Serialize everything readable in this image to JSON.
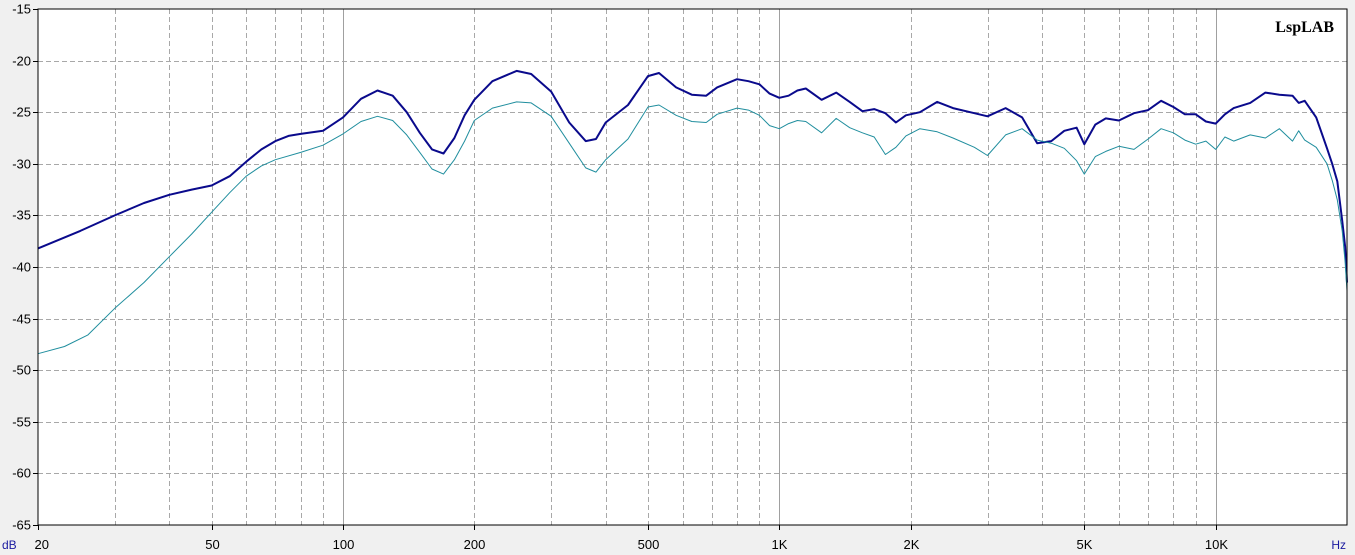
{
  "chart_data": {
    "type": "line",
    "brand": "LspLAB",
    "y_unit_label": "dB",
    "x_unit_label": "Hz",
    "x_scale": "log",
    "xlim": [
      20,
      20000
    ],
    "ylim": [
      -65,
      -15
    ],
    "grid": true,
    "x_ticks": [
      {
        "value": 20,
        "label": "20"
      },
      {
        "value": 50,
        "label": "50"
      },
      {
        "value": 100,
        "label": "100"
      },
      {
        "value": 200,
        "label": "200"
      },
      {
        "value": 500,
        "label": "500"
      },
      {
        "value": 1000,
        "label": "1K"
      },
      {
        "value": 2000,
        "label": "2K"
      },
      {
        "value": 5000,
        "label": "5K"
      },
      {
        "value": 10000,
        "label": "10K"
      }
    ],
    "y_ticks": [
      {
        "value": -15,
        "label": "-15"
      },
      {
        "value": -20,
        "label": "-20"
      },
      {
        "value": -25,
        "label": "-25"
      },
      {
        "value": -30,
        "label": "-30"
      },
      {
        "value": -35,
        "label": "-35"
      },
      {
        "value": -40,
        "label": "-40"
      },
      {
        "value": -45,
        "label": "-45"
      },
      {
        "value": -50,
        "label": "-50"
      },
      {
        "value": -55,
        "label": "-55"
      },
      {
        "value": -60,
        "label": "-60"
      },
      {
        "value": -65,
        "label": "-65"
      }
    ],
    "colors": {
      "background": "#ffffff",
      "grid_major": "#a0a0a0",
      "grid_minor": "#a8a8a8"
    },
    "series": [
      {
        "color": "#0a0a8c",
        "points": [
          [
            20,
            -38.2
          ],
          [
            25,
            -36.5
          ],
          [
            30,
            -35
          ],
          [
            35,
            -33.8
          ],
          [
            40,
            -33
          ],
          [
            45,
            -32.5
          ],
          [
            50,
            -32.1
          ],
          [
            55,
            -31.2
          ],
          [
            60,
            -29.8
          ],
          [
            65,
            -28.6
          ],
          [
            70,
            -27.8
          ],
          [
            75,
            -27.3
          ],
          [
            80,
            -27.1
          ],
          [
            90,
            -26.8
          ],
          [
            100,
            -25.5
          ],
          [
            110,
            -23.7
          ],
          [
            120,
            -22.9
          ],
          [
            130,
            -23.4
          ],
          [
            140,
            -25
          ],
          [
            150,
            -27
          ],
          [
            160,
            -28.6
          ],
          [
            170,
            -29
          ],
          [
            180,
            -27.5
          ],
          [
            190,
            -25.3
          ],
          [
            200,
            -23.8
          ],
          [
            220,
            -22
          ],
          [
            250,
            -21
          ],
          [
            270,
            -21.3
          ],
          [
            300,
            -23
          ],
          [
            330,
            -26
          ],
          [
            360,
            -27.8
          ],
          [
            380,
            -27.6
          ],
          [
            400,
            -26
          ],
          [
            450,
            -24.3
          ],
          [
            500,
            -21.5
          ],
          [
            530,
            -21.2
          ],
          [
            580,
            -22.6
          ],
          [
            630,
            -23.3
          ],
          [
            680,
            -23.4
          ],
          [
            720,
            -22.6
          ],
          [
            800,
            -21.8
          ],
          [
            850,
            -22
          ],
          [
            900,
            -22.3
          ],
          [
            950,
            -23.2
          ],
          [
            1000,
            -23.6
          ],
          [
            1050,
            -23.4
          ],
          [
            1100,
            -22.9
          ],
          [
            1150,
            -22.7
          ],
          [
            1250,
            -23.8
          ],
          [
            1350,
            -23.1
          ],
          [
            1450,
            -24
          ],
          [
            1550,
            -24.9
          ],
          [
            1650,
            -24.7
          ],
          [
            1750,
            -25.1
          ],
          [
            1850,
            -26
          ],
          [
            1950,
            -25.3
          ],
          [
            2100,
            -25
          ],
          [
            2300,
            -24
          ],
          [
            2500,
            -24.6
          ],
          [
            2800,
            -25.1
          ],
          [
            3000,
            -25.4
          ],
          [
            3300,
            -24.6
          ],
          [
            3600,
            -25.5
          ],
          [
            3900,
            -28
          ],
          [
            4200,
            -27.8
          ],
          [
            4500,
            -26.8
          ],
          [
            4800,
            -26.5
          ],
          [
            5000,
            -28.1
          ],
          [
            5300,
            -26.2
          ],
          [
            5600,
            -25.6
          ],
          [
            6000,
            -25.8
          ],
          [
            6500,
            -25.1
          ],
          [
            7000,
            -24.8
          ],
          [
            7500,
            -23.9
          ],
          [
            8000,
            -24.5
          ],
          [
            8500,
            -25.2
          ],
          [
            9000,
            -25.2
          ],
          [
            9500,
            -25.9
          ],
          [
            10000,
            -26.1
          ],
          [
            10500,
            -25.2
          ],
          [
            11000,
            -24.6
          ],
          [
            12000,
            -24.1
          ],
          [
            13000,
            -23.1
          ],
          [
            14000,
            -23.3
          ],
          [
            15000,
            -23.4
          ],
          [
            15500,
            -24.1
          ],
          [
            16000,
            -23.9
          ],
          [
            17000,
            -25.5
          ],
          [
            18000,
            -28.5
          ],
          [
            18500,
            -30
          ],
          [
            19000,
            -31.7
          ],
          [
            19500,
            -35.5
          ],
          [
            19800,
            -38
          ],
          [
            20000,
            -41.5
          ]
        ]
      },
      {
        "color": "#208e9e",
        "points": [
          [
            20,
            -48.4
          ],
          [
            23,
            -47.7
          ],
          [
            26,
            -46.6
          ],
          [
            30,
            -44
          ],
          [
            35,
            -41.5
          ],
          [
            40,
            -39
          ],
          [
            45,
            -36.8
          ],
          [
            50,
            -34.7
          ],
          [
            55,
            -32.8
          ],
          [
            60,
            -31.2
          ],
          [
            65,
            -30.2
          ],
          [
            70,
            -29.6
          ],
          [
            80,
            -28.9
          ],
          [
            90,
            -28.2
          ],
          [
            100,
            -27.1
          ],
          [
            110,
            -25.9
          ],
          [
            120,
            -25.4
          ],
          [
            130,
            -25.8
          ],
          [
            140,
            -27.2
          ],
          [
            150,
            -28.9
          ],
          [
            160,
            -30.5
          ],
          [
            170,
            -31
          ],
          [
            180,
            -29.6
          ],
          [
            190,
            -27.8
          ],
          [
            200,
            -25.8
          ],
          [
            220,
            -24.6
          ],
          [
            250,
            -24
          ],
          [
            270,
            -24.1
          ],
          [
            300,
            -25.4
          ],
          [
            330,
            -28
          ],
          [
            360,
            -30.4
          ],
          [
            380,
            -30.8
          ],
          [
            400,
            -29.6
          ],
          [
            450,
            -27.6
          ],
          [
            500,
            -24.5
          ],
          [
            530,
            -24.3
          ],
          [
            580,
            -25.3
          ],
          [
            630,
            -25.9
          ],
          [
            680,
            -26
          ],
          [
            720,
            -25.2
          ],
          [
            800,
            -24.6
          ],
          [
            850,
            -24.8
          ],
          [
            900,
            -25.3
          ],
          [
            950,
            -26.3
          ],
          [
            1000,
            -26.6
          ],
          [
            1050,
            -26.1
          ],
          [
            1100,
            -25.8
          ],
          [
            1150,
            -25.9
          ],
          [
            1250,
            -27
          ],
          [
            1350,
            -25.6
          ],
          [
            1450,
            -26.5
          ],
          [
            1550,
            -27
          ],
          [
            1650,
            -27.4
          ],
          [
            1750,
            -29.1
          ],
          [
            1850,
            -28.4
          ],
          [
            1950,
            -27.3
          ],
          [
            2100,
            -26.6
          ],
          [
            2300,
            -26.9
          ],
          [
            2500,
            -27.5
          ],
          [
            2800,
            -28.4
          ],
          [
            3000,
            -29.2
          ],
          [
            3300,
            -27.2
          ],
          [
            3600,
            -26.6
          ],
          [
            3900,
            -27.7
          ],
          [
            4200,
            -28
          ],
          [
            4500,
            -28.5
          ],
          [
            4800,
            -29.7
          ],
          [
            5000,
            -31
          ],
          [
            5300,
            -29.3
          ],
          [
            5600,
            -28.8
          ],
          [
            6000,
            -28.3
          ],
          [
            6500,
            -28.6
          ],
          [
            7000,
            -27.6
          ],
          [
            7500,
            -26.6
          ],
          [
            8000,
            -27
          ],
          [
            8500,
            -27.7
          ],
          [
            9000,
            -28.1
          ],
          [
            9500,
            -27.8
          ],
          [
            10000,
            -28.6
          ],
          [
            10500,
            -27.4
          ],
          [
            11000,
            -27.8
          ],
          [
            12000,
            -27.2
          ],
          [
            13000,
            -27.5
          ],
          [
            14000,
            -26.6
          ],
          [
            15000,
            -27.8
          ],
          [
            15500,
            -26.8
          ],
          [
            16000,
            -27.7
          ],
          [
            17000,
            -28.4
          ],
          [
            18000,
            -30
          ],
          [
            18500,
            -31.6
          ],
          [
            19000,
            -33.5
          ],
          [
            19500,
            -36.5
          ],
          [
            19800,
            -39.5
          ],
          [
            20000,
            -42.3
          ]
        ]
      }
    ]
  }
}
